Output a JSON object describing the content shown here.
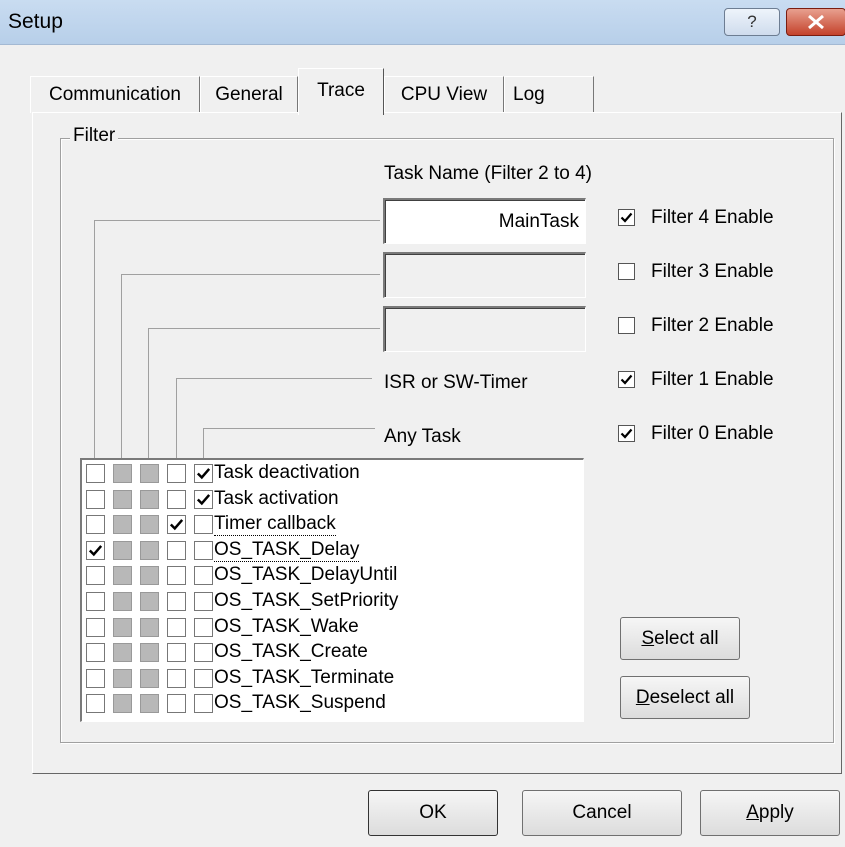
{
  "window": {
    "title": "Setup",
    "help_label": "?"
  },
  "tabs": [
    {
      "label": "Communication"
    },
    {
      "label": "General"
    },
    {
      "label": "Trace"
    },
    {
      "label": "CPU View"
    },
    {
      "label": "Log"
    }
  ],
  "filter": {
    "group_label": "Filter",
    "task_name_label": "Task Name (Filter 2 to 4)",
    "task_name_value": "MainTask",
    "isr_label": "ISR or SW-Timer",
    "any_task_label": "Any Task",
    "enables": [
      {
        "label": "Filter 4 Enable",
        "checked": true
      },
      {
        "label": "Filter 3 Enable",
        "checked": false
      },
      {
        "label": "Filter 2 Enable",
        "checked": false
      },
      {
        "label": "Filter 1 Enable",
        "checked": true
      },
      {
        "label": "Filter 0 Enable",
        "checked": true
      }
    ]
  },
  "events": [
    {
      "label": "Task deactivation",
      "checks": [
        false,
        false,
        false,
        false,
        true
      ]
    },
    {
      "label": "Task activation",
      "checks": [
        false,
        false,
        false,
        false,
        true
      ]
    },
    {
      "label": "Timer callback",
      "checks": [
        false,
        false,
        false,
        true,
        false
      ]
    },
    {
      "label": "OS_TASK_Delay",
      "checks": [
        true,
        false,
        false,
        false,
        false
      ]
    },
    {
      "label": "OS_TASK_DelayUntil",
      "checks": [
        false,
        false,
        false,
        false,
        false
      ]
    },
    {
      "label": "OS_TASK_SetPriority",
      "checks": [
        false,
        false,
        false,
        false,
        false
      ]
    },
    {
      "label": "OS_TASK_Wake",
      "checks": [
        false,
        false,
        false,
        false,
        false
      ]
    },
    {
      "label": "OS_TASK_Create",
      "checks": [
        false,
        false,
        false,
        false,
        false
      ]
    },
    {
      "label": "OS_TASK_Terminate",
      "checks": [
        false,
        false,
        false,
        false,
        false
      ]
    },
    {
      "label": "OS_TASK_Suspend",
      "checks": [
        false,
        false,
        false,
        false,
        false
      ]
    }
  ],
  "buttons": {
    "select_all": "Select all",
    "select_all_key": "S",
    "select_all_rest": "elect all",
    "deselect_all": "Deselect all",
    "deselect_all_key": "D",
    "deselect_all_rest": "eselect all",
    "ok": "OK",
    "cancel": "Cancel",
    "apply": "Apply",
    "apply_key": "A",
    "apply_rest": "pply"
  }
}
